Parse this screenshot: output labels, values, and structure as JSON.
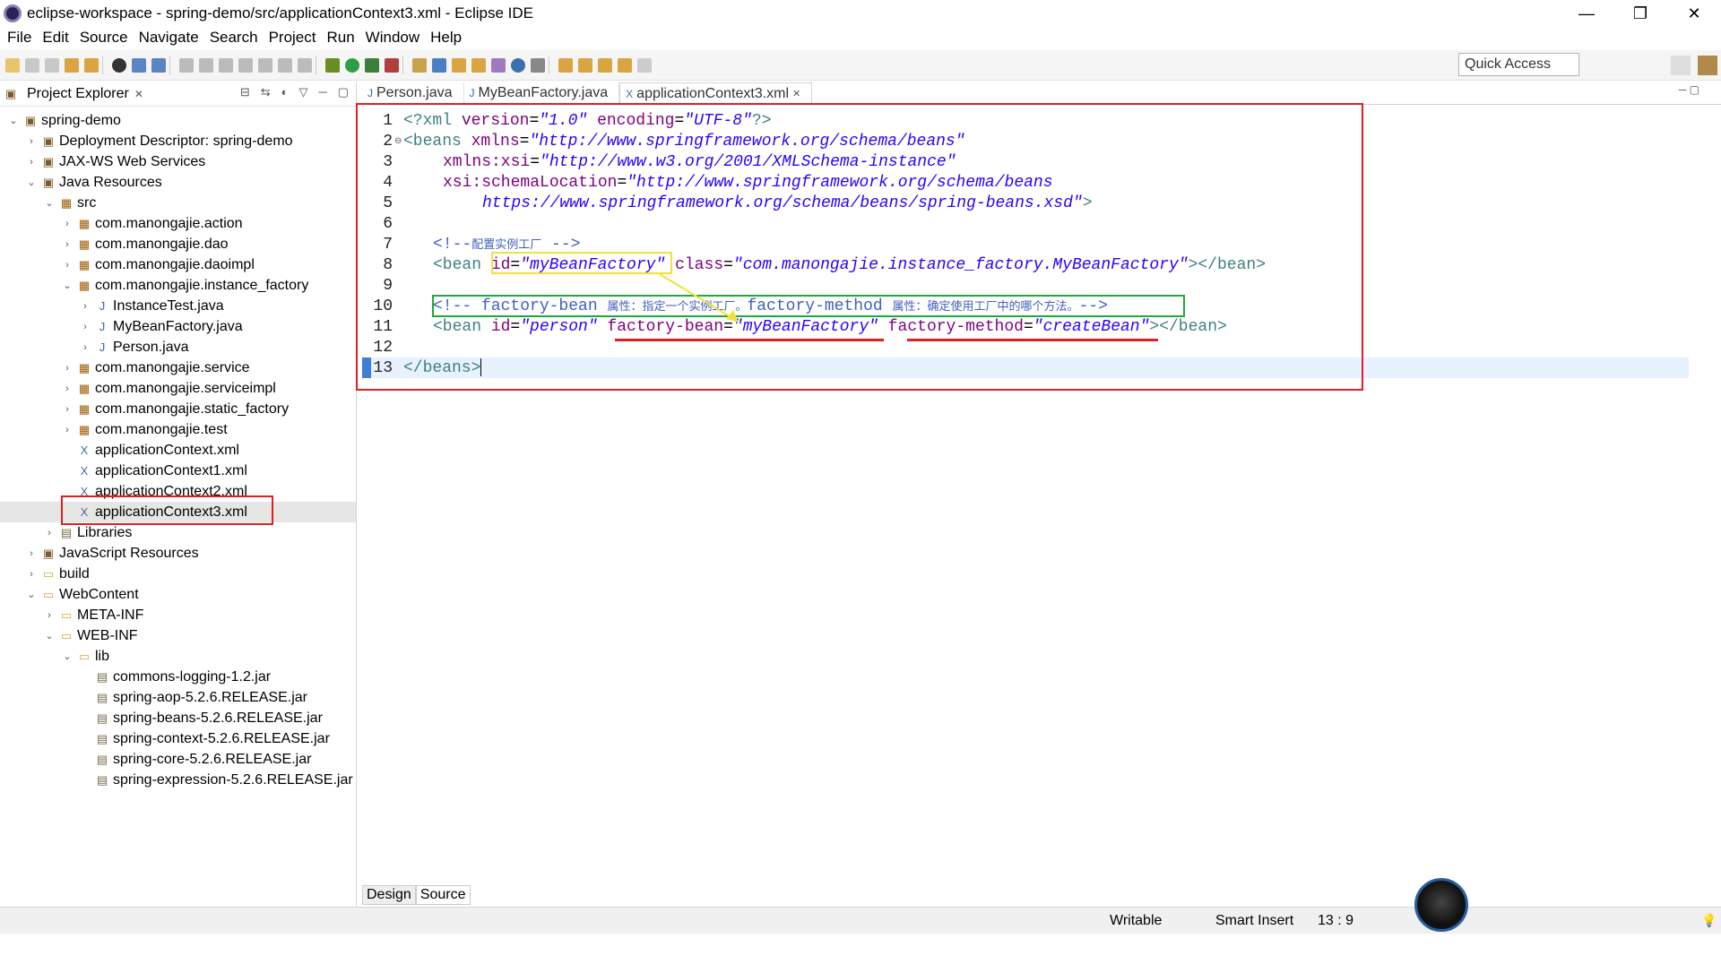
{
  "window": {
    "title": "eclipse-workspace - spring-demo/src/applicationContext3.xml - Eclipse IDE",
    "minimize": "—",
    "restore": "❐",
    "close": "✕"
  },
  "menu": [
    "File",
    "Edit",
    "Source",
    "Navigate",
    "Search",
    "Project",
    "Run",
    "Window",
    "Help"
  ],
  "toolbar": {
    "quick_access": "Quick Access"
  },
  "explorer": {
    "title": "Project Explorer",
    "items": [
      {
        "label": "spring-demo",
        "indent": 0,
        "tw": "⌄",
        "icon": "proj"
      },
      {
        "label": "Deployment Descriptor: spring-demo",
        "indent": 1,
        "tw": "›",
        "icon": "proj"
      },
      {
        "label": "JAX-WS Web Services",
        "indent": 1,
        "tw": "›",
        "icon": "proj"
      },
      {
        "label": "Java Resources",
        "indent": 1,
        "tw": "⌄",
        "icon": "proj"
      },
      {
        "label": "src",
        "indent": 2,
        "tw": "⌄",
        "icon": "pkg"
      },
      {
        "label": "com.manongajie.action",
        "indent": 3,
        "tw": "›",
        "icon": "pkg"
      },
      {
        "label": "com.manongajie.dao",
        "indent": 3,
        "tw": "›",
        "icon": "pkg"
      },
      {
        "label": "com.manongajie.daoimpl",
        "indent": 3,
        "tw": "›",
        "icon": "pkg"
      },
      {
        "label": "com.manongajie.instance_factory",
        "indent": 3,
        "tw": "⌄",
        "icon": "pkg"
      },
      {
        "label": "InstanceTest.java",
        "indent": 4,
        "tw": "›",
        "icon": "java"
      },
      {
        "label": "MyBeanFactory.java",
        "indent": 4,
        "tw": "›",
        "icon": "java"
      },
      {
        "label": "Person.java",
        "indent": 4,
        "tw": "›",
        "icon": "java"
      },
      {
        "label": "com.manongajie.service",
        "indent": 3,
        "tw": "›",
        "icon": "pkg"
      },
      {
        "label": "com.manongajie.serviceimpl",
        "indent": 3,
        "tw": "›",
        "icon": "pkg"
      },
      {
        "label": "com.manongajie.static_factory",
        "indent": 3,
        "tw": "›",
        "icon": "pkg"
      },
      {
        "label": "com.manongajie.test",
        "indent": 3,
        "tw": "›",
        "icon": "pkg"
      },
      {
        "label": "applicationContext.xml",
        "indent": 3,
        "tw": "",
        "icon": "xml"
      },
      {
        "label": "applicationContext1.xml",
        "indent": 3,
        "tw": "",
        "icon": "xml"
      },
      {
        "label": "applicationContext2.xml",
        "indent": 3,
        "tw": "",
        "icon": "xml"
      },
      {
        "label": "applicationContext3.xml",
        "indent": 3,
        "tw": "",
        "icon": "xml",
        "selected": true
      },
      {
        "label": "Libraries",
        "indent": 2,
        "tw": "›",
        "icon": "jar"
      },
      {
        "label": "JavaScript Resources",
        "indent": 1,
        "tw": "›",
        "icon": "proj"
      },
      {
        "label": "build",
        "indent": 1,
        "tw": "›",
        "icon": "folder"
      },
      {
        "label": "WebContent",
        "indent": 1,
        "tw": "⌄",
        "icon": "folder"
      },
      {
        "label": "META-INF",
        "indent": 2,
        "tw": "›",
        "icon": "folder"
      },
      {
        "label": "WEB-INF",
        "indent": 2,
        "tw": "⌄",
        "icon": "folder"
      },
      {
        "label": "lib",
        "indent": 3,
        "tw": "⌄",
        "icon": "folder"
      },
      {
        "label": "commons-logging-1.2.jar",
        "indent": 4,
        "tw": "",
        "icon": "jar"
      },
      {
        "label": "spring-aop-5.2.6.RELEASE.jar",
        "indent": 4,
        "tw": "",
        "icon": "jar"
      },
      {
        "label": "spring-beans-5.2.6.RELEASE.jar",
        "indent": 4,
        "tw": "",
        "icon": "jar"
      },
      {
        "label": "spring-context-5.2.6.RELEASE.jar",
        "indent": 4,
        "tw": "",
        "icon": "jar"
      },
      {
        "label": "spring-core-5.2.6.RELEASE.jar",
        "indent": 4,
        "tw": "",
        "icon": "jar"
      },
      {
        "label": "spring-expression-5.2.6.RELEASE.jar",
        "indent": 4,
        "tw": "",
        "icon": "jar"
      }
    ]
  },
  "tabs": [
    {
      "label": "Person.java",
      "active": false
    },
    {
      "label": "MyBeanFactory.java",
      "active": false
    },
    {
      "label": "applicationContext3.xml",
      "active": true
    }
  ],
  "code": {
    "l1": {
      "n": "1",
      "a": "<?xml ",
      "b": "version",
      "c": "=",
      "d": "\"1.0\"",
      "e": " encoding",
      "f": "=",
      "g": "\"UTF-8\"",
      "h": "?>"
    },
    "l2": {
      "n": "2",
      "a": "<beans ",
      "b": "xmlns",
      "c": "=",
      "d": "\"http://www.springframework.org/schema/beans\""
    },
    "l3": {
      "n": "3",
      "b": "xmlns:xsi",
      "c": "=",
      "d": "\"http://www.w3.org/2001/XMLSchema-instance\""
    },
    "l4": {
      "n": "4",
      "b": "xsi:schemaLocation",
      "c": "=",
      "d": "\"http://www.springframework.org/schema/beans"
    },
    "l5": {
      "n": "5",
      "d": "https://www.springframework.org/schema/beans/spring-beans.xsd\"",
      "h": ">"
    },
    "l6": {
      "n": "6"
    },
    "l7": {
      "n": "7",
      "a": "<!--",
      "cjk": "配置实例工厂",
      "z": " -->"
    },
    "l8": {
      "n": "8",
      "a": "<bean ",
      "b": "id",
      "c": "=",
      "d": "\"myBeanFactory\"",
      "e": " class",
      "f": "=",
      "g": "\"com.manongajie.instance_factory.MyBeanFactory\"",
      "h": "></bean>"
    },
    "l9": {
      "n": "9"
    },
    "l10": {
      "n": "10",
      "a": "<!-- factory-bean ",
      "cjk1": "属性：指定一个实例工厂。",
      "m": "factory-method ",
      "cjk2": "属性：确定使用工厂中的哪个方法。",
      "z": "-->"
    },
    "l11": {
      "n": "11",
      "a": "<bean ",
      "b": "id",
      "c": "=",
      "d": "\"person\"",
      "e": " factory-bean",
      "f": "=",
      "g": "\"myBeanFactory\"",
      "i": " factory-method",
      "j": "=",
      "k": "\"createBean\"",
      "h": "></bean>"
    },
    "l12": {
      "n": "12"
    },
    "l13": {
      "n": "13",
      "a": "</beans>"
    }
  },
  "bottom_tabs": {
    "design": "Design",
    "source": "Source"
  },
  "status": {
    "writable": "Writable",
    "insert": "Smart Insert",
    "pos": "13 : 9"
  },
  "colors": {
    "annotation_red": "#e02020",
    "annotation_yellow": "#f1e23a",
    "annotation_green": "#21a83a"
  }
}
